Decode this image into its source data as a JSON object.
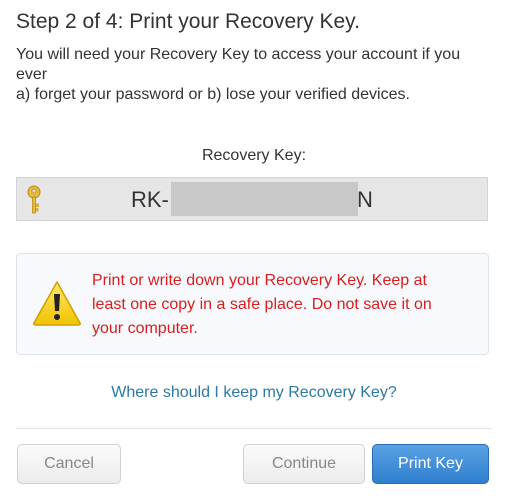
{
  "header": {
    "title": "Step 2 of 4: Print your Recovery Key."
  },
  "description": {
    "line1": "You will need your Recovery Key to access your account if you",
    "line2": "ever",
    "line3": "a) forget your password or b) lose your verified devices."
  },
  "recovery_key": {
    "label": "Recovery Key:",
    "prefix": "RK-",
    "suffix": "N",
    "icon": "key-icon"
  },
  "warning": {
    "icon": "warning-icon",
    "line1": "Print or write down your Recovery Key. Keep at",
    "line2": "least one copy in a safe place. Do not save it on",
    "line3": "your computer.",
    "color": "#d81e1e"
  },
  "help": {
    "link_text": "Where should I keep my Recovery Key?",
    "color": "#2a79a8"
  },
  "footer": {
    "cancel_label": "Cancel",
    "continue_label": "Continue",
    "print_label": "Print Key",
    "primary_color": "#3a8bd8"
  }
}
